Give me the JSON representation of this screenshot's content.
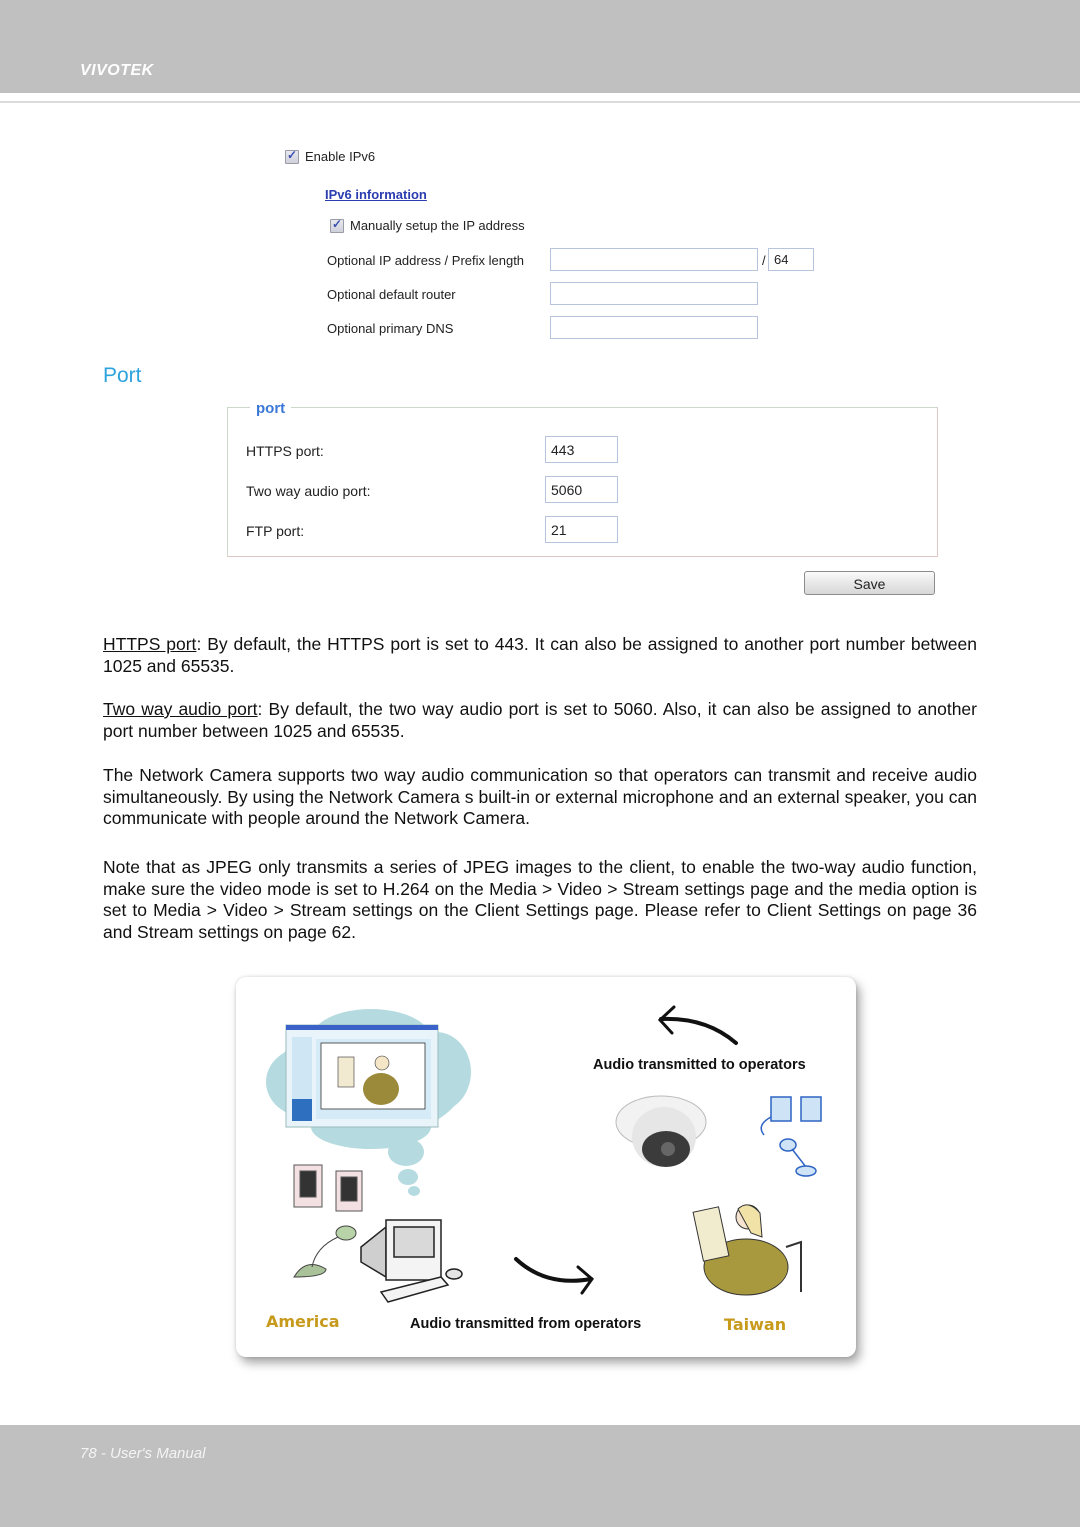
{
  "header": {
    "brand": "VIVOTEK"
  },
  "ipv6": {
    "enable_label": "Enable IPv6",
    "enable_checked": true,
    "info_link": "IPv6 information",
    "manual_label": "Manually setup the IP address",
    "manual_checked": true,
    "ip_prefix_label": "Optional IP address / Prefix length",
    "ip_value": "",
    "slash": "/",
    "prefix_value": "64",
    "router_label": "Optional default router",
    "router_value": "",
    "dns_label": "Optional primary DNS",
    "dns_value": ""
  },
  "port_section": {
    "title": "Port",
    "legend": "port",
    "rows": [
      {
        "label": "HTTPS port:",
        "value": "443"
      },
      {
        "label": "Two way audio port:",
        "value": "5060"
      },
      {
        "label": "FTP port:",
        "value": "21"
      }
    ],
    "save_label": "Save"
  },
  "body_text": {
    "p1_term": "HTTPS port",
    "p1_rest": ": By default, the HTTPS port is set to 443. It can also be assigned to another port number between 1025 and 65535.",
    "p2_term": "Two way audio port",
    "p2_rest": ": By default, the two way audio port is set to 5060. Also, it can also be assigned to another port number between 1025 and 65535.",
    "p3": "The Network Camera supports two way audio communication so that operators can transmit and receive audio simultaneously. By using the Network Camera s built-in or external microphone and an external speaker, you can communicate with people around the Network Camera.",
    "p4": "Note that as JPEG only transmits a series of JPEG images to the client, to enable the two-way audio function, make sure the video mode is set to  H.264  on the Media > Video > Stream settings page and the media option is set to  Media > Video > Stream settings  on the Client Settings page. Please refer to Client Settings on page 36 and Stream settings on page 62."
  },
  "illustration": {
    "caption_to": "Audio transmitted to operators",
    "caption_from": "Audio transmitted from operators",
    "place_left": "America",
    "place_right": "Taiwan"
  },
  "footer": {
    "page_label": "78 - User's Manual"
  }
}
